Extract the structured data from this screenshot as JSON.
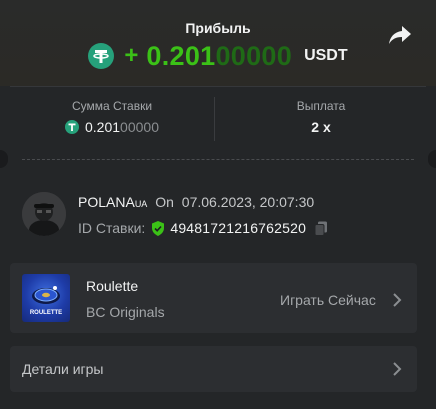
{
  "header": {
    "title": "Прибыль",
    "profit_sign": "+",
    "profit_value_bright": "0.201",
    "profit_value_dim": "00000",
    "currency": "USDT",
    "share_icon": "share-icon"
  },
  "summary": {
    "bet_amount_label": "Сумма Ставки",
    "bet_amount_bright": "0.201",
    "bet_amount_dim": "00000",
    "payout_label": "Выплата",
    "payout_value": "2 x"
  },
  "player": {
    "name": "POLANA",
    "name_suffix": "UA",
    "date_prefix": "On",
    "date": "07.06.2023, 20:07:30",
    "bet_id_label": "ID Ставки:",
    "bet_id": "49481721216762520"
  },
  "game": {
    "name": "Roulette",
    "provider": "BC Originals",
    "play_label": "Играть Сейчас",
    "thumb_label": "ROULETTE"
  },
  "details": {
    "label": "Детали игры"
  },
  "colors": {
    "accent_green": "#3bc117",
    "usdt": "#26a17b",
    "background": "#242628"
  }
}
